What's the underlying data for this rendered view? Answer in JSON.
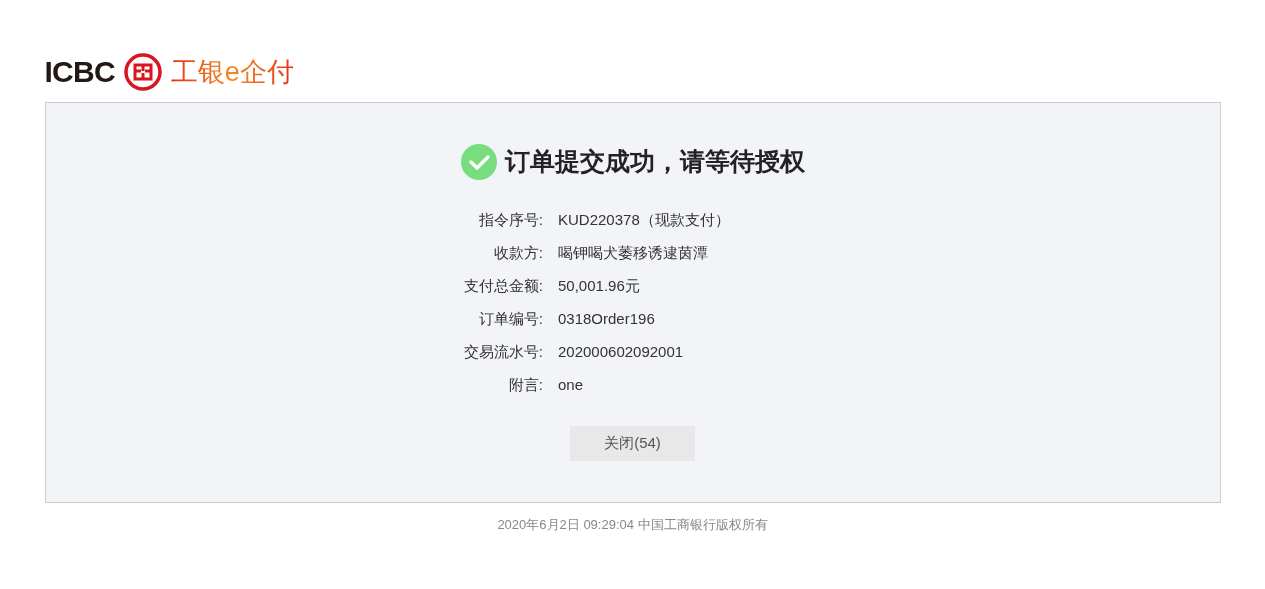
{
  "logo": {
    "bank": "ICBC",
    "product": "工银e企付"
  },
  "result": {
    "succeeded": true,
    "title": "订单提交成功，请等待授权"
  },
  "details": [
    {
      "label": "指令序号:",
      "value": "KUD220378（现款支付）"
    },
    {
      "label": "收款方:",
      "value": "喝钾喝犬萎移诱逮茵潭"
    },
    {
      "label": "支付总金额:",
      "value": "50,001.96元"
    },
    {
      "label": "订单编号:",
      "value": "0318Order196"
    },
    {
      "label": "交易流水号:",
      "value": "202000602092001"
    },
    {
      "label": "附言:",
      "value": "one"
    }
  ],
  "close_button": "关闭(54)",
  "footer": "2020年6月2日 09:29:04 中国工商银行版权所有"
}
